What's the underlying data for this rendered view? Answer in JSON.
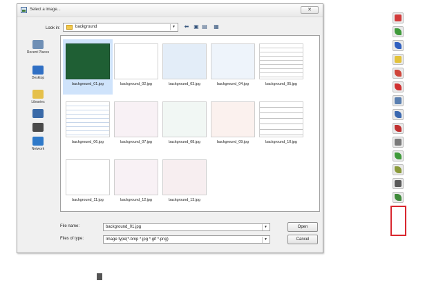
{
  "dialog": {
    "title": "Select a image...",
    "close_label": "✕",
    "look_in_label": "Look in:",
    "look_in_value": "background",
    "places": [
      {
        "label": "Recent Places",
        "icon": "recent-places-icon",
        "color": "#6f8fb5"
      },
      {
        "label": "Desktop",
        "icon": "desktop-icon",
        "color": "#2f6fc4"
      },
      {
        "label": "Libraries",
        "icon": "libraries-icon",
        "color": "#e5c04a"
      },
      {
        "label": "",
        "icon": "computer-icon",
        "color": "#3a6aa8"
      },
      {
        "label": "",
        "icon": "user-icon",
        "color": "#4a4a4a"
      },
      {
        "label": "Network",
        "icon": "network-icon",
        "color": "#2e79c9"
      }
    ],
    "files": [
      {
        "name": "background_01.jpg",
        "style": "green"
      },
      {
        "name": "background_02.jpg",
        "style": "white"
      },
      {
        "name": "background_03.jpg",
        "style": "lightblue"
      },
      {
        "name": "background_04.jpg",
        "style": "paleblue"
      },
      {
        "name": "background_05.jpg",
        "style": "lines"
      },
      {
        "name": "background_06.jpg",
        "style": "bluelines"
      },
      {
        "name": "background_07.jpg",
        "style": "pink"
      },
      {
        "name": "background_08.jpg",
        "style": "mint"
      },
      {
        "name": "background_09.jpg",
        "style": "peach"
      },
      {
        "name": "background_10.jpg",
        "style": "bullets"
      },
      {
        "name": "background_11.jpg",
        "style": "white"
      },
      {
        "name": "background_12.jpg",
        "style": "pink"
      },
      {
        "name": "background_13.jpg",
        "style": "rose"
      }
    ],
    "file_name_label": "File name:",
    "file_name_value": "background_01.jpg",
    "file_type_label": "Files of type:",
    "file_type_value": "Image type(*.bmp *.jpg *.gif *.png)",
    "open_label": "Open",
    "cancel_label": "Cancel"
  },
  "colors": {
    "selected": "#cfe3fb",
    "green_thumb": "#1f5f34",
    "highlight": "#d9262e"
  },
  "tools": [
    {
      "icon": "red-pen-icon",
      "color": "#d23a3a"
    },
    {
      "icon": "green-pen-icon",
      "color": "#3f9a3a"
    },
    {
      "icon": "blue-pen-icon",
      "color": "#3060c0"
    },
    {
      "icon": "highlighter-icon",
      "color": "#e3c23a"
    },
    {
      "icon": "shapes-icon",
      "color": "#d0453a"
    },
    {
      "icon": "number-icon",
      "color": "#d03030"
    },
    {
      "icon": "eraser-icon",
      "color": "#5a7fb0"
    },
    {
      "icon": "edit-icon",
      "color": "#3a68b0"
    },
    {
      "icon": "stamp-icon",
      "color": "#c03030"
    },
    {
      "icon": "screen-icon",
      "color": "#7a7a7a"
    },
    {
      "icon": "image-icon",
      "color": "#3f9a3a"
    },
    {
      "icon": "background-image-icon",
      "color": "#8a9a3a"
    },
    {
      "icon": "settings-icon",
      "color": "#5a5a5a"
    },
    {
      "icon": "exit-icon",
      "color": "#3f8a3a"
    }
  ]
}
